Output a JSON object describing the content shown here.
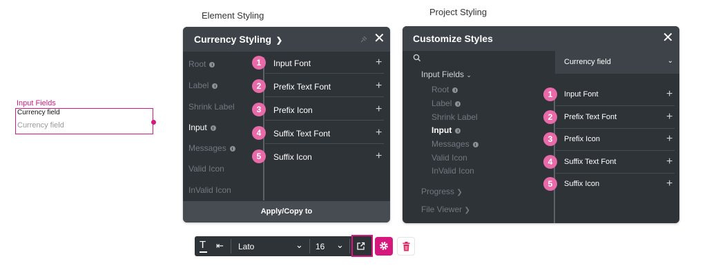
{
  "widget": {
    "label": "Input Fields",
    "sublabel": "Currency field",
    "placeholder": "Currency field"
  },
  "captions": {
    "element_styling": "Element Styling",
    "project_styling": "Project Styling"
  },
  "element_panel": {
    "title": "Currency Styling",
    "sidebar": [
      "Root",
      "Label",
      "Shrink Label",
      "Input",
      "Messages",
      "Valid Icon",
      "InValid Icon"
    ],
    "active_sidebar_item": "Input",
    "items": [
      {
        "num": "1",
        "label": "Input Font"
      },
      {
        "num": "2",
        "label": "Prefix Text Font"
      },
      {
        "num": "3",
        "label": "Prefix Icon"
      },
      {
        "num": "4",
        "label": "Suffix Text Font"
      },
      {
        "num": "5",
        "label": "Suffix Icon"
      }
    ],
    "footer_button": "Apply/Copy to"
  },
  "project_panel": {
    "title": "Customize Styles",
    "group": "Input Fields",
    "tree": [
      "Root",
      "Label",
      "Shrink Label",
      "Input",
      "Messages",
      "Valid Icon",
      "InValid Icon"
    ],
    "active_tree_item": "Input",
    "other_groups": [
      "Progress",
      "File Viewer"
    ],
    "dropdown_value": "Currency field",
    "items": [
      {
        "num": "1",
        "label": "Input Font"
      },
      {
        "num": "2",
        "label": "Prefix Text Font"
      },
      {
        "num": "3",
        "label": "Prefix Icon"
      },
      {
        "num": "4",
        "label": "Suffix Text Font"
      },
      {
        "num": "5",
        "label": "Suffix Icon"
      }
    ]
  },
  "toolbar": {
    "font": "Lato",
    "size": "16"
  },
  "colors": {
    "accent": "#d6187e",
    "badge": "#e86aa9",
    "panel": "#2e3338",
    "panel_header": "#3d4349"
  }
}
